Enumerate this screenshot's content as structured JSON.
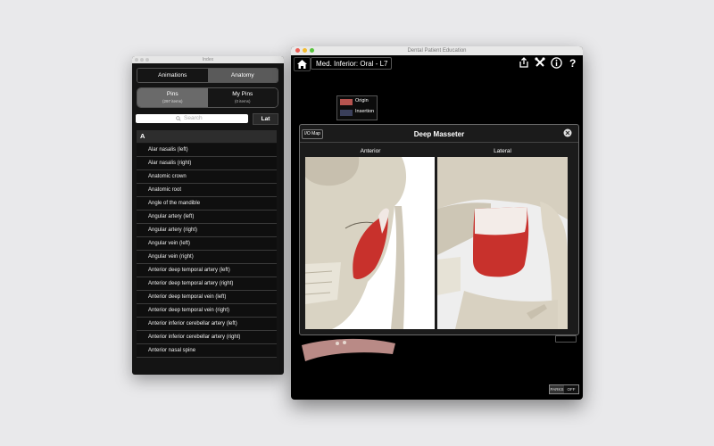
{
  "index_window": {
    "title": "Index",
    "tabs": [
      {
        "label": "Animations"
      },
      {
        "label": "Anatomy"
      }
    ],
    "pins": {
      "label": "Pins",
      "count": "(297 items)"
    },
    "my_pins": {
      "label": "My Pins",
      "count": "(0 items)"
    },
    "search_placeholder": "Search",
    "lat_button": "Lat",
    "section_header": "A",
    "items": [
      {
        "label": "Alar nasalis (left)"
      },
      {
        "label": "Alar nasalis (right)"
      },
      {
        "label": "Anatomic crown"
      },
      {
        "label": "Anatomic root"
      },
      {
        "label": "Angle of the mandible"
      },
      {
        "label": "Angular artery (left)"
      },
      {
        "label": "Angular artery (right)"
      },
      {
        "label": "Angular vein (left)"
      },
      {
        "label": "Angular vein (right)"
      },
      {
        "label": "Anterior deep temporal artery (left)"
      },
      {
        "label": "Anterior deep temporal artery (right)"
      },
      {
        "label": "Anterior deep temporal vein (left)"
      },
      {
        "label": "Anterior deep temporal vein (right)"
      },
      {
        "label": "Anterior inferior cerebellar artery (left)"
      },
      {
        "label": "Anterior inferior cerebellar artery (right)"
      },
      {
        "label": "Anterior nasal spine"
      }
    ]
  },
  "main_window": {
    "title": "Dental Patient Education",
    "breadcrumb": "Med. Inferior: Oral - L7",
    "legend": {
      "origin": "Origin",
      "insertion": "Insertion",
      "origin_color": "#b5534f",
      "insertion_color": "#3a3f5a"
    },
    "popup": {
      "io_map_button": "I/O Map",
      "title": "Deep Masseter",
      "left_label": "Anterior",
      "right_label": "Lateral"
    },
    "footer_toggle": {
      "left": "PARKS",
      "right": "OFF"
    }
  },
  "colors": {
    "muscle_red": "#c8312c",
    "bone": "#d8d2c3"
  }
}
